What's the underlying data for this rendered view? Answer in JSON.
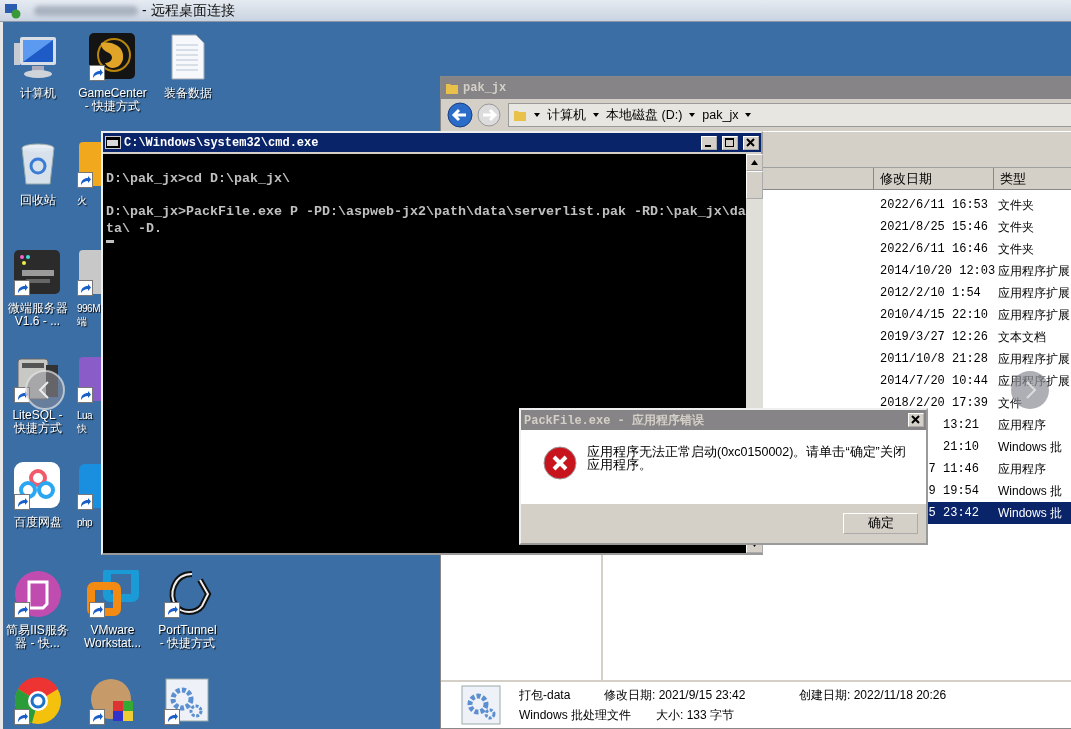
{
  "remote_title_bar": {
    "title": "- 远程桌面连接"
  },
  "desktop_icons": [
    {
      "kind": "computer",
      "label": [
        "计算机"
      ]
    },
    {
      "kind": "dragon",
      "label": [
        "GameCenter",
        "- 快捷方式"
      ]
    },
    {
      "kind": "document",
      "label": [
        "装备数据"
      ]
    },
    {
      "kind": "recycle",
      "label": [
        "回收站"
      ]
    },
    {
      "kind": "orange",
      "label": [
        "火"
      ]
    },
    {
      "kind": "chip",
      "label": [
        "微端服务器",
        "V1.6 - ..."
      ]
    },
    {
      "kind": "gray",
      "label": [
        "996M",
        "端"
      ]
    },
    {
      "kind": "printer",
      "label": [
        "LiteSQL -",
        "快捷方式"
      ]
    },
    {
      "kind": "purple",
      "label": [
        "Lua",
        "快"
      ]
    },
    {
      "kind": "cloud",
      "label": [
        "百度网盘"
      ]
    },
    {
      "kind": "blue",
      "label": [
        "php"
      ]
    },
    {
      "kind": "iis",
      "label": [
        "简易IIS服务",
        "器 - 快..."
      ]
    },
    {
      "kind": "vmware",
      "label": [
        "VMware",
        "Workstat..."
      ]
    },
    {
      "kind": "tunnel",
      "label": [
        "PortTunnel",
        "- 快捷方式"
      ]
    },
    {
      "kind": "browser"
    },
    {
      "kind": "archive"
    },
    {
      "kind": "gear"
    }
  ],
  "explorer": {
    "title": "pak_jx",
    "breadcrumb": [
      "计算机",
      "本地磁盘 (D:)",
      "pak_jx"
    ],
    "columns": [
      "修改日期",
      "类型"
    ],
    "rows": [
      {
        "date": "2022/6/11 16:53",
        "type": "文件夹",
        "selected": false
      },
      {
        "date": "2021/8/25 15:46",
        "type": "文件夹",
        "selected": false
      },
      {
        "date": "2022/6/11 16:46",
        "type": "文件夹",
        "selected": false
      },
      {
        "date": "2014/10/20 12:03",
        "type": "应用程序扩展",
        "selected": false
      },
      {
        "date": "2012/2/10 1:54",
        "type": "应用程序扩展",
        "selected": false
      },
      {
        "date": "2010/4/15 22:10",
        "type": "应用程序扩展",
        "selected": false
      },
      {
        "date": "2019/3/27 12:26",
        "type": "文本文档",
        "selected": false
      },
      {
        "date": "2011/10/8 21:28",
        "type": "应用程序扩展",
        "selected": false
      },
      {
        "date": "2014/7/20 10:44",
        "type": "应用程序扩展",
        "selected": false
      },
      {
        "date": "2018/2/20 17:39",
        "type": "文件",
        "selected": false
      },
      {
        "date": "13:21",
        "type": "应用程序",
        "selected": false
      },
      {
        "date": "21:10",
        "type": "Windows 批",
        "selected": false
      },
      {
        "date": "7 11:46",
        "type": "应用程序",
        "selected": false
      },
      {
        "date": "9 19:54",
        "type": "Windows 批",
        "selected": false
      },
      {
        "date": "5 23:42",
        "type": "Windows 批",
        "selected": true
      }
    ],
    "details": {
      "name": "打包-data",
      "type": "Windows 批处理文件",
      "modified": "修改日期: 2021/9/15 23:42",
      "size": "大小: 133 字节",
      "created": "创建日期: 2022/11/18 20:26"
    }
  },
  "console": {
    "title": "C:\\Windows\\system32\\cmd.exe",
    "lines": [
      "D:\\pak_jx>cd D:\\pak_jx\\",
      "D:\\pak_jx>PackFile.exe P -PD:\\aspweb-jx2\\path\\data\\serverlist.pak -RD:\\pak_jx\\data\\ -D."
    ]
  },
  "dialog": {
    "title": "PackFile.exe - 应用程序错误",
    "message": "应用程序无法正常启动(0xc0150002)。请单击“确定”关闭应用程序。",
    "button": "确定"
  }
}
